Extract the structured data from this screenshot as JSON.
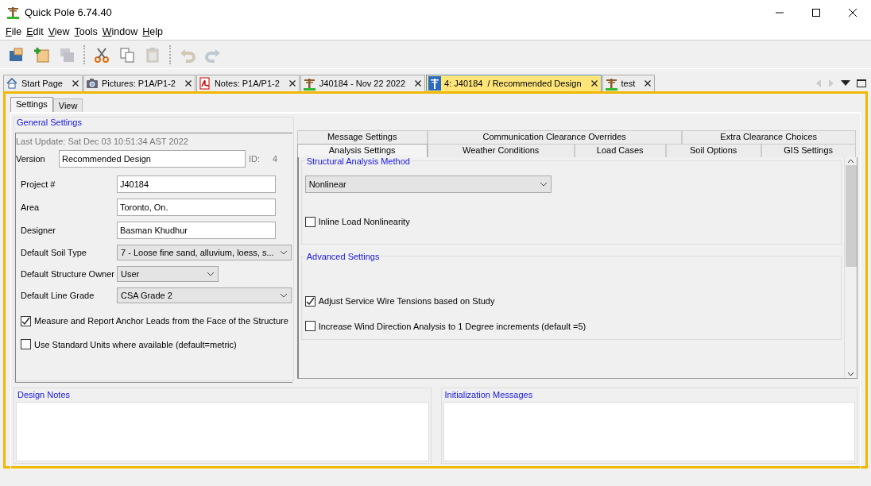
{
  "window": {
    "title": "Quick Pole 6.74.40"
  },
  "menu": [
    "File",
    "Edit",
    "View",
    "Tools",
    "Window",
    "Help"
  ],
  "toolbar": [
    {
      "kind": "open",
      "disabled": false
    },
    {
      "kind": "new",
      "disabled": false
    },
    {
      "kind": "save",
      "disabled": true
    },
    {
      "kind": "sep"
    },
    {
      "kind": "cut",
      "disabled": false
    },
    {
      "kind": "copy",
      "disabled": false
    },
    {
      "kind": "paste",
      "disabled": true
    },
    {
      "kind": "sep"
    },
    {
      "kind": "undo",
      "disabled": true
    },
    {
      "kind": "redo",
      "disabled": true
    }
  ],
  "doc_tabs": [
    {
      "kind": "start",
      "label": "Start Page",
      "selected": false
    },
    {
      "kind": "pictures",
      "label": "Pictures: P1A/P1-2",
      "selected": false
    },
    {
      "kind": "notes",
      "label": "Notes: P1A/P1-2",
      "selected": false
    },
    {
      "kind": "pole",
      "label": "J40184 - Nov 22 2022",
      "selected": false
    },
    {
      "kind": "version",
      "label": "4: J40184  / Recommended Design",
      "selected": true
    },
    {
      "kind": "pole",
      "label": "test",
      "selected": false
    }
  ],
  "inner_tabs": [
    {
      "label": "Settings",
      "selected": true
    },
    {
      "label": "View",
      "selected": false
    }
  ],
  "general_settings": {
    "title": "General Settings",
    "last_update": "Last Update: Sat Dec 03 10:51:34 AST 2022",
    "version_label": "Version",
    "version_value": "Recommended Design",
    "id_label": "ID:",
    "id_value": "4",
    "fields": [
      {
        "kind": "text",
        "label": "Project #",
        "value": "J40184"
      },
      {
        "kind": "text",
        "label": "Area",
        "value": "Toronto, On."
      },
      {
        "kind": "text",
        "label": "Designer",
        "value": "Basman Khudhur"
      },
      {
        "kind": "select",
        "label": "Default Soil Type",
        "value": "7 - Loose fine sand, alluvium, loess, s..."
      },
      {
        "kind": "select-short",
        "label": "Default Structure Owner",
        "value": "User"
      },
      {
        "kind": "select",
        "label": "Default Line Grade",
        "value": "CSA Grade 2"
      }
    ],
    "checkboxes": [
      {
        "label": "Measure and Report Anchor Leads from the Face of the Structure",
        "checked": true
      },
      {
        "label": "Use Standard Units where available (default=metric)",
        "checked": false
      }
    ]
  },
  "settings_tabs": [
    [
      {
        "label": "Message Settings",
        "selected": false
      },
      {
        "label": "Communication Clearance Overrides",
        "selected": false
      },
      {
        "label": "Extra Clearance Choices",
        "selected": false
      }
    ],
    [
      {
        "label": "Analysis Settings",
        "selected": true
      },
      {
        "label": "Weather Conditions",
        "selected": false
      },
      {
        "label": "Load Cases",
        "selected": false
      },
      {
        "label": "Soil Options",
        "selected": false
      },
      {
        "label": "GIS Settings",
        "selected": false
      }
    ]
  ],
  "analysis": {
    "method_title": "Structural Analysis Method",
    "method_value": "Nonlinear",
    "method_checkboxes": [
      {
        "label": "Inline Load Nonlinearity",
        "checked": false
      }
    ],
    "advanced_title": "Advanced Settings",
    "advanced_checkboxes": [
      {
        "label": "Adjust Service Wire Tensions based on Study",
        "checked": true
      },
      {
        "label": "Increase Wind Direction Analysis to 1 Degree increments (default =5)",
        "checked": false
      }
    ]
  },
  "bottom_panels": [
    {
      "title": "Design Notes"
    },
    {
      "title": "Initialization Messages"
    }
  ]
}
